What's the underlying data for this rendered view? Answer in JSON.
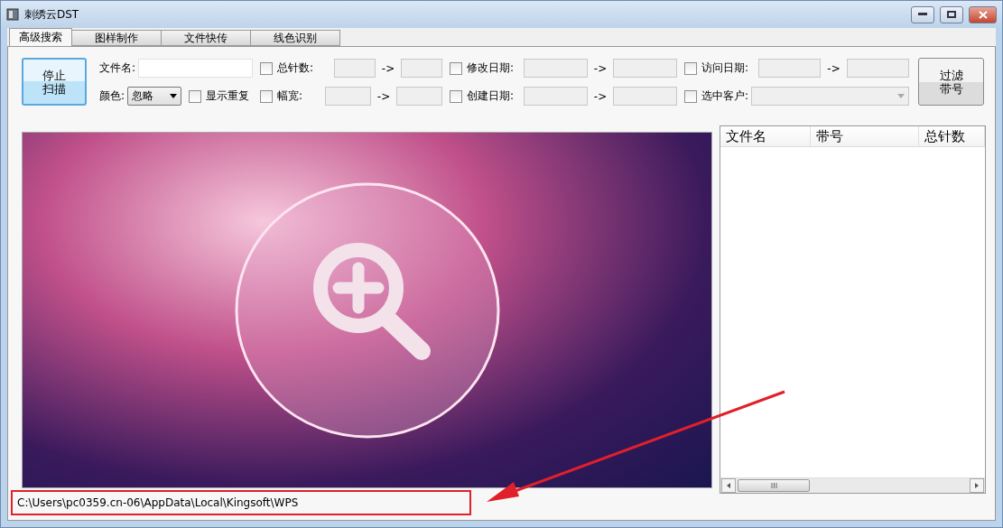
{
  "window": {
    "title": "刺绣云DST"
  },
  "tabs": [
    {
      "label": "高级搜索",
      "selected": true
    },
    {
      "label": "图样制作",
      "selected": false
    },
    {
      "label": "文件快传",
      "selected": false
    },
    {
      "label": "线色识别",
      "selected": false
    }
  ],
  "stop_button": {
    "lines": [
      "停止",
      "扫描"
    ]
  },
  "filter_button": {
    "lines": [
      "过滤",
      "带号"
    ]
  },
  "filter_rows": [
    [
      {
        "kind": "text",
        "label": "文件名:"
      },
      {
        "kind": "range",
        "label": "总针数:",
        "checked": false,
        "separator": "->"
      },
      {
        "kind": "range",
        "label": "修改日期:",
        "checked": false,
        "separator": "->"
      },
      {
        "kind": "range",
        "label": "访问日期:",
        "checked": false,
        "separator": "->"
      }
    ],
    [
      {
        "kind": "select",
        "label": "颜色:",
        "value": "忽略"
      },
      {
        "kind": "check",
        "label": "显示重复",
        "checked": false
      },
      {
        "kind": "range",
        "label": "幅宽:",
        "checked": false,
        "separator": "->"
      },
      {
        "kind": "range",
        "label": "创建日期:",
        "checked": false,
        "separator": "->"
      },
      {
        "kind": "combo",
        "label": "选中客户:",
        "checked": false,
        "disabled": true
      }
    ]
  ],
  "results": {
    "columns": [
      "文件名",
      "带号",
      "总针数"
    ]
  },
  "status_bar": {
    "path": "C:\\Users\\pc0359.cn-06\\AppData\\Local\\Kingsoft\\WPS",
    "highlighted": true
  }
}
